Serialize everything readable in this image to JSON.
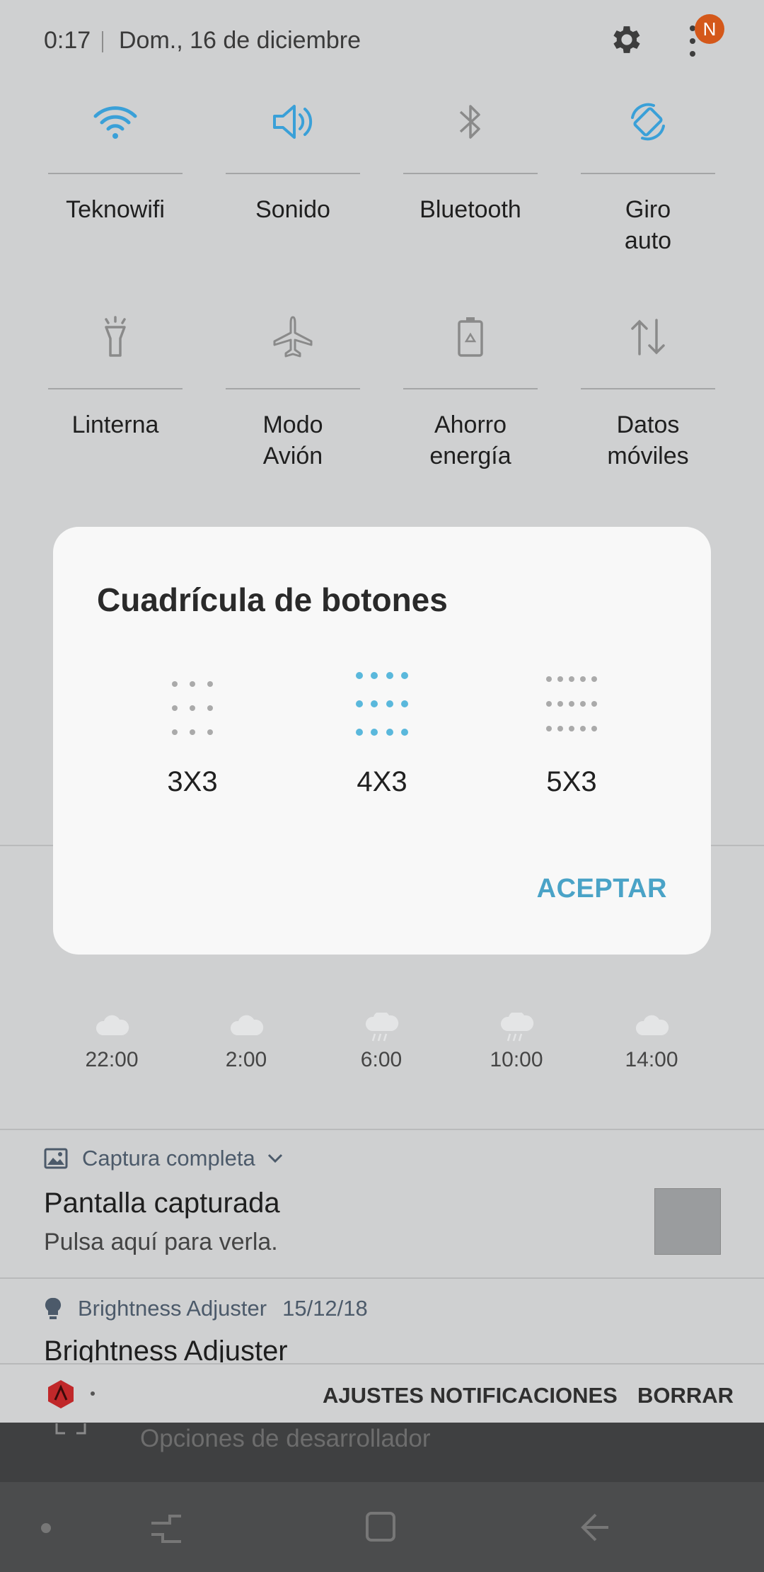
{
  "status": {
    "time": "0:17",
    "date": "Dom., 16 de diciembre",
    "notif_badge": "N"
  },
  "tiles": [
    {
      "label": "Teknowifi",
      "icon": "wifi-icon",
      "active": true
    },
    {
      "label": "Sonido",
      "icon": "sound-icon",
      "active": true
    },
    {
      "label": "Bluetooth",
      "icon": "bluetooth-icon",
      "active": false
    },
    {
      "label": "Giro\nauto",
      "icon": "auto-rotate-icon",
      "active": true
    },
    {
      "label": "Linterna",
      "icon": "flashlight-icon",
      "active": false
    },
    {
      "label": "Modo\nAvión",
      "icon": "airplane-icon",
      "active": false
    },
    {
      "label": "Ahorro\nenergía",
      "icon": "power-saving-icon",
      "active": false
    },
    {
      "label": "Datos\nmóviles",
      "icon": "mobile-data-icon",
      "active": false
    }
  ],
  "weather": {
    "hours": [
      "22:00",
      "2:00",
      "6:00",
      "10:00",
      "14:00"
    ]
  },
  "notifications": [
    {
      "app": "Captura completa",
      "title": "Pantalla capturada",
      "text": "Pulsa aquí para verla."
    },
    {
      "app": "Brightness Adjuster",
      "date": "15/12/18",
      "title": "Brightness Adjuster"
    }
  ],
  "actions": {
    "settings": "AJUSTES NOTIFICACIONES",
    "clear": "BORRAR"
  },
  "underlay": {
    "developer_options": "Opciones de desarrollador"
  },
  "dialog": {
    "title": "Cuadrícula de botones",
    "options": [
      {
        "label": "3X3",
        "selected": false
      },
      {
        "label": "4X3",
        "selected": true
      },
      {
        "label": "5X3",
        "selected": false
      }
    ],
    "accept": "ACEPTAR"
  },
  "colors": {
    "accent": "#3aa0d8",
    "dialog_accept": "#4aa3c7",
    "dot_selected": "#5ab8dc",
    "dot_unselected": "#aaaaaa"
  }
}
